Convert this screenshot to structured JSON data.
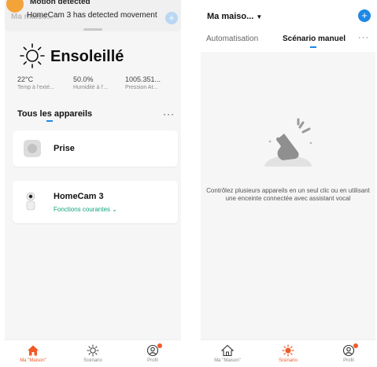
{
  "left": {
    "notification": {
      "title": "Motion detected",
      "body": "HomeCam 3 has detected movement",
      "home_ghost": "Ma maiso..."
    },
    "weather": {
      "condition": "Ensoleillé",
      "stats": [
        {
          "value": "22°C",
          "label": "Temp à l'exté..."
        },
        {
          "value": "50.0%",
          "label": "Humidité à l'..."
        },
        {
          "value": "1005.351...",
          "label": "Pression At..."
        }
      ]
    },
    "devices_title": "Tous les appareils",
    "devices": [
      {
        "name": "Prise"
      },
      {
        "name": "HomeCam 3",
        "function_label": "Fonctions courantes"
      }
    ],
    "tabs": [
      {
        "label": "Ma \"Maison\"",
        "icon": "home-icon",
        "active": true
      },
      {
        "label": "Scénario",
        "icon": "sun-icon",
        "active": false
      },
      {
        "label": "Profil",
        "icon": "profile-icon",
        "active": false
      }
    ]
  },
  "right": {
    "home_selector": "Ma maiso...",
    "tabs_top": [
      "Automatisation",
      "Scénario manuel"
    ],
    "empty_message": "Contrôlez plusieurs appareils en un seul clic ou en utilisant une enceinte connectée avec assistant vocal",
    "tabs": [
      {
        "label": "Ma \"Maison\"",
        "icon": "home-icon",
        "active": false
      },
      {
        "label": "Scénario",
        "icon": "sun-icon",
        "active": true
      },
      {
        "label": "Profil",
        "icon": "profile-icon",
        "active": false
      }
    ]
  },
  "colors": {
    "accent_blue": "#1e88e5",
    "active_orange": "#f05a28",
    "green_link": "#12a37a"
  }
}
